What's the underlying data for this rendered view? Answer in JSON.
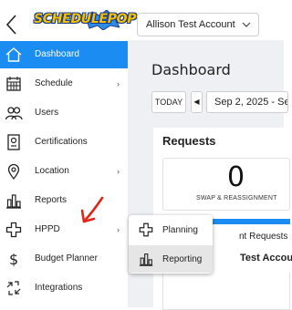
{
  "header": {
    "back_icon": "chevron-left-icon",
    "logo_text": "SCHEDULEPOP",
    "account_selector": {
      "value": "Allison Test Account",
      "icon": "chevron-down-icon"
    }
  },
  "sidebar": {
    "items": [
      {
        "label": "Dashboard",
        "icon": "home-icon",
        "active": true,
        "has_submenu": false
      },
      {
        "label": "Schedule",
        "icon": "calendar-icon",
        "active": false,
        "has_submenu": true
      },
      {
        "label": "Users",
        "icon": "users-icon",
        "active": false,
        "has_submenu": false
      },
      {
        "label": "Certifications",
        "icon": "certificate-icon",
        "active": false,
        "has_submenu": false
      },
      {
        "label": "Location",
        "icon": "location-pin-icon",
        "active": false,
        "has_submenu": true
      },
      {
        "label": "Reports",
        "icon": "bar-chart-icon",
        "active": false,
        "has_submenu": false
      },
      {
        "label": "HPPD",
        "icon": "plus-cross-icon",
        "active": false,
        "has_submenu": true
      },
      {
        "label": "Budget Planner",
        "icon": "dollar-icon",
        "active": false,
        "has_submenu": false
      },
      {
        "label": "Integrations",
        "icon": "integrations-icon",
        "active": false,
        "has_submenu": false
      }
    ],
    "submenu_caret": "›"
  },
  "hppd_flyout": {
    "items": [
      {
        "label": "Planning",
        "icon": "plus-cross-icon",
        "hovered": false
      },
      {
        "label": "Reporting",
        "icon": "bar-chart-icon",
        "hovered": true
      }
    ]
  },
  "main": {
    "title": "Dashboard",
    "today_button": "TODAY",
    "prev_button": "◀",
    "date_range": "Sep 2, 2025 - Se",
    "requests_card": {
      "title": "Requests",
      "count": "0",
      "count_label": "SWAP & REASSIGNMENT",
      "sub_header": "nt Requests",
      "account_row": "Test Account"
    }
  },
  "colors": {
    "accent": "#1a8cf2",
    "annotation": "#e0261b",
    "main_bg": "#eef0f3"
  }
}
